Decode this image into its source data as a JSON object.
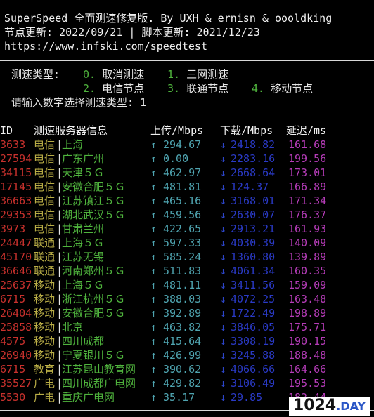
{
  "header": {
    "title_line": "SuperSpeed 全面测速修复版. By UXH & ernisn & oooldking",
    "update_line": "节点更新: 2022/09/21 | 脚本更新: 2021/12/23",
    "url_line": "https://www.infski.com/speedtest"
  },
  "menu": {
    "label": "测速类型:",
    "options": [
      {
        "num": "0.",
        "text": "取消测速"
      },
      {
        "num": "1.",
        "text": "三网测速"
      },
      {
        "num": "2.",
        "text": "电信节点"
      },
      {
        "num": "3.",
        "text": "联通节点"
      },
      {
        "num": "4.",
        "text": "移动节点"
      }
    ],
    "prompt": "请输入数字选择测速类型: 1"
  },
  "table": {
    "headers": {
      "id": "ID",
      "server": "测速服务器信息",
      "upload": "上传/Mbps",
      "download": "下载/Mbps",
      "latency": "延迟/ms"
    },
    "arrow_up": "↑",
    "arrow_down": "↓",
    "separator": "|",
    "rows": [
      {
        "id": "3633",
        "isp": "电信",
        "loc": "上海",
        "up": "294.67",
        "down": "2418.82",
        "lat": "161.68"
      },
      {
        "id": "27594",
        "isp": "电信",
        "loc": "广东广州",
        "up": "0.00",
        "down": "2283.16",
        "lat": "199.56"
      },
      {
        "id": "34115",
        "isp": "电信",
        "loc": "天津５Ｇ",
        "up": "462.97",
        "down": "2668.64",
        "lat": "173.01"
      },
      {
        "id": "17145",
        "isp": "电信",
        "loc": "安徽合肥５Ｇ",
        "up": "481.81",
        "down": "124.37",
        "lat": "166.89"
      },
      {
        "id": "36663",
        "isp": "电信",
        "loc": "江苏镇江５Ｇ",
        "up": "465.16",
        "down": "3168.01",
        "lat": "171.34"
      },
      {
        "id": "29353",
        "isp": "电信",
        "loc": "湖北武汉５Ｇ",
        "up": "459.56",
        "down": "2630.07",
        "lat": "176.37"
      },
      {
        "id": "3973",
        "isp": "电信",
        "loc": "甘肃兰州",
        "up": "422.65",
        "down": "2913.21",
        "lat": "161.93"
      },
      {
        "id": "24447",
        "isp": "联通",
        "loc": "上海５Ｇ",
        "up": "597.33",
        "down": "4030.39",
        "lat": "140.09"
      },
      {
        "id": "45170",
        "isp": "联通",
        "loc": "江苏无锡",
        "up": "585.24",
        "down": "1360.80",
        "lat": "139.89"
      },
      {
        "id": "36646",
        "isp": "联通",
        "loc": "河南郑州５Ｇ",
        "up": "511.83",
        "down": "4061.34",
        "lat": "160.35"
      },
      {
        "id": "25637",
        "isp": "移动",
        "loc": "上海５Ｇ",
        "up": "481.11",
        "down": "3411.56",
        "lat": "159.09"
      },
      {
        "id": "6715",
        "isp": "移动",
        "loc": "浙江杭州５Ｇ",
        "up": "388.03",
        "down": "4072.25",
        "lat": "163.48"
      },
      {
        "id": "26404",
        "isp": "移动",
        "loc": "安徽合肥５Ｇ",
        "up": "392.89",
        "down": "1722.49",
        "lat": "198.89"
      },
      {
        "id": "25858",
        "isp": "移动",
        "loc": "北京",
        "up": "463.82",
        "down": "3846.05",
        "lat": "175.71"
      },
      {
        "id": "4575",
        "isp": "移动",
        "loc": "四川成都",
        "up": "415.64",
        "down": "3308.19",
        "lat": "190.15"
      },
      {
        "id": "26940",
        "isp": "移动",
        "loc": "宁夏银川５Ｇ",
        "up": "426.99",
        "down": "3245.88",
        "lat": "188.48"
      },
      {
        "id": "6715",
        "isp": "教育",
        "loc": "江苏昆山教育网",
        "up": "390.62",
        "down": "4066.66",
        "lat": "164.66"
      },
      {
        "id": "35527",
        "isp": "广电",
        "loc": "四川成都广电网",
        "up": "429.82",
        "down": "3106.49",
        "lat": "195.53"
      },
      {
        "id": "5530",
        "isp": "广电",
        "loc": "重庆广电网",
        "up": "35.17",
        "down": "29.85",
        "lat": "182.44"
      }
    ]
  },
  "watermark": {
    "main": "1024",
    "suffix": ".DAY"
  }
}
